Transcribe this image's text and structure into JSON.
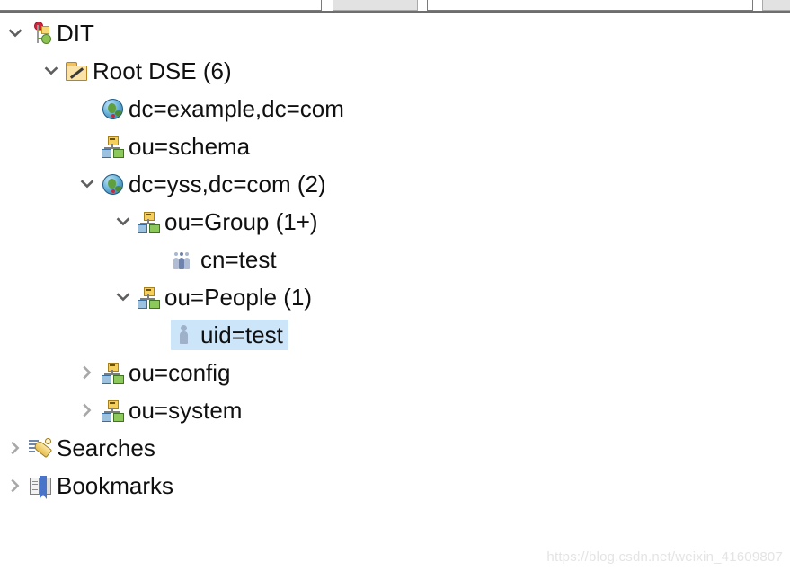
{
  "toolbar": {
    "fields": [
      {
        "name": "toolbar-field-left",
        "value": "",
        "placeholder": ""
      },
      {
        "name": "toolbar-field-right",
        "value": "",
        "placeholder": ""
      }
    ],
    "buttons": [
      {
        "name": "toolbar-button-left",
        "label": ""
      },
      {
        "name": "toolbar-button-right",
        "label": ""
      }
    ]
  },
  "tree": {
    "selected_label": "uid=test",
    "selection_color": "#cde5f8",
    "rows": [
      {
        "label": "DIT",
        "icon": "dit-icon",
        "indent": 0,
        "twisty": "expanded",
        "selected": false
      },
      {
        "label": "Root DSE (6)",
        "icon": "folder-icon",
        "indent": 1,
        "twisty": "expanded",
        "selected": false
      },
      {
        "label": "dc=example,dc=com",
        "icon": "globe-icon",
        "indent": 2,
        "twisty": "none",
        "selected": false
      },
      {
        "label": "ou=schema",
        "icon": "org-unit-icon",
        "indent": 2,
        "twisty": "none",
        "selected": false
      },
      {
        "label": "dc=yss,dc=com (2)",
        "icon": "globe-icon",
        "indent": 2,
        "twisty": "expanded",
        "selected": false
      },
      {
        "label": "ou=Group (1+)",
        "icon": "org-unit-icon",
        "indent": 3,
        "twisty": "expanded",
        "selected": false
      },
      {
        "label": "cn=test",
        "icon": "group-icon",
        "indent": 4,
        "twisty": "none",
        "selected": false
      },
      {
        "label": "ou=People (1)",
        "icon": "org-unit-icon",
        "indent": 3,
        "twisty": "expanded",
        "selected": false
      },
      {
        "label": "uid=test",
        "icon": "person-icon",
        "indent": 4,
        "twisty": "none",
        "selected": true
      },
      {
        "label": "ou=config",
        "icon": "org-unit-icon",
        "indent": 2,
        "twisty": "collapsed",
        "selected": false
      },
      {
        "label": "ou=system",
        "icon": "org-unit-icon",
        "indent": 2,
        "twisty": "collapsed",
        "selected": false
      },
      {
        "label": "Searches",
        "icon": "rocket-icon",
        "indent": 0,
        "twisty": "collapsed",
        "selected": false
      },
      {
        "label": "Bookmarks",
        "icon": "book-icon",
        "indent": 0,
        "twisty": "collapsed",
        "selected": false
      }
    ]
  },
  "watermark": {
    "text": "https://blog.csdn.net/weixin_41609807"
  }
}
